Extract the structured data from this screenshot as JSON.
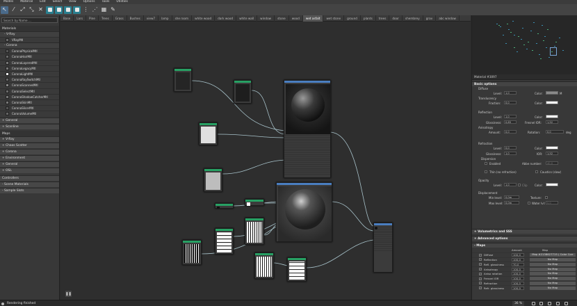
{
  "menubar": [
    "Modes",
    "Material",
    "Edit",
    "Select",
    "View",
    "Options",
    "Tools",
    "Utilities"
  ],
  "search": {
    "placeholder": "Search by Name ..."
  },
  "left": {
    "title": "Materials",
    "vray": "- V-Ray",
    "vray_item": "VRayMtl",
    "corona": "- Corona",
    "corona_items": [
      "CoronaPhysicalMtl",
      "CoronaHairMtl",
      "CoronaLayeredMtl",
      "CoronaLegacyMtl",
      "CoronaLightMtl",
      "CoronaRaySwitchMtl",
      "CoronaScannedMtl",
      "CoronaSelectMtl",
      "CoronaShadowCatcherMtl",
      "CoronaSkinMtl",
      "CoronaSlicerMtl",
      "CoronaVolumeMtl"
    ],
    "general": "+ General",
    "scanline": "+ Scanline",
    "maps_title": "Maps",
    "maps_items": [
      "+ V-Ray",
      "+ Chaos Scatter",
      "+ Corona",
      "+ Environment",
      "+ General",
      "+ OSL"
    ],
    "controllers": "Controllers",
    "scene_materials": "- Scene Materials",
    "sample_slots": "- Sample Slots"
  },
  "tabs": [
    "Base",
    "Lars",
    "Pine",
    "Trees",
    "Grass",
    "Bushes",
    "view7",
    "lamp",
    "she room",
    "white wood",
    "dark wood",
    "white wall",
    "window",
    "stone",
    "wood",
    "wet asfalt",
    "wet stone",
    "ground",
    "plants",
    "trees",
    "door",
    "shembrey",
    "grav",
    "abc window"
  ],
  "active_tab": "wet asfalt",
  "right": {
    "title": "Material #3097",
    "basic": "Basic options",
    "diffuse": "Diffuse",
    "level_lbl": "Level:",
    "diffuse_level": "1,0",
    "color_lbl": "Color:",
    "m_lbl": "M",
    "translucency": "Translucency",
    "fraction_lbl": "Fraction:",
    "fraction": "0,0",
    "reflection": "Reflection",
    "refl_level": "1,0",
    "glossiness_lbl": "Glossiness:",
    "refl_gloss": "0,65",
    "fresnel_lbl": "Fresnel IOR:",
    "fresnel": "1,52",
    "anisotropy": "Anisotropy",
    "amount_lbl": "Amount:",
    "aniso_amount": "0,0",
    "rotation_lbl": "Rotation:",
    "aniso_rot": "0,0",
    "deg": "deg",
    "refraction": "Refraction",
    "refr_level": "0,0",
    "refr_gloss": "1,0",
    "ior_lbl": "IOR:",
    "ior": "1,52",
    "dispersion": "Dispersion",
    "enabled": "Enabled",
    "abbe_lbl": "Abbe number:",
    "abbe": "40,0",
    "thin": "Thin (no refraction)",
    "caustics": "Caustics (slow)",
    "opacity": "Opacity",
    "opacity_level": "1,0",
    "clip": "Clip",
    "displacement": "Displacement",
    "min_lbl": "Min level:",
    "min_level": "0,0m",
    "max_lbl": "Max level:",
    "max_level": "0,0m",
    "texture_lbl": "Texture:",
    "water_lbl": "Water lvl:",
    "water": "0,0",
    "volumetrics": "+ Volumetrics and SSS",
    "advanced": "+ Advanced options",
    "maps": "- Maps",
    "amount_col": "Amount",
    "map_col": "Map",
    "map_rows": [
      {
        "name": "Diffuse",
        "amount": "100,0",
        "map": "Map #2138627715 ( Color Corr"
      },
      {
        "name": "Reflection",
        "amount": "100,0",
        "map": "No Map"
      },
      {
        "name": "Refl. glossiness",
        "amount": "70,0",
        "map": "No Map"
      },
      {
        "name": "Anisotropy",
        "amount": "100,0",
        "map": "No Map"
      },
      {
        "name": "Aniso rotation",
        "amount": "100,0",
        "map": "No Map"
      },
      {
        "name": "Fresnel IOR",
        "amount": "100,0",
        "map": "No Map"
      },
      {
        "name": "Refraction",
        "amount": "100,0",
        "map": "No Map"
      },
      {
        "name": "Refr. glossiness",
        "amount": "100,0",
        "map": "No Map"
      }
    ]
  },
  "status": {
    "text": "Rendering finished",
    "zoom": "36 %"
  }
}
